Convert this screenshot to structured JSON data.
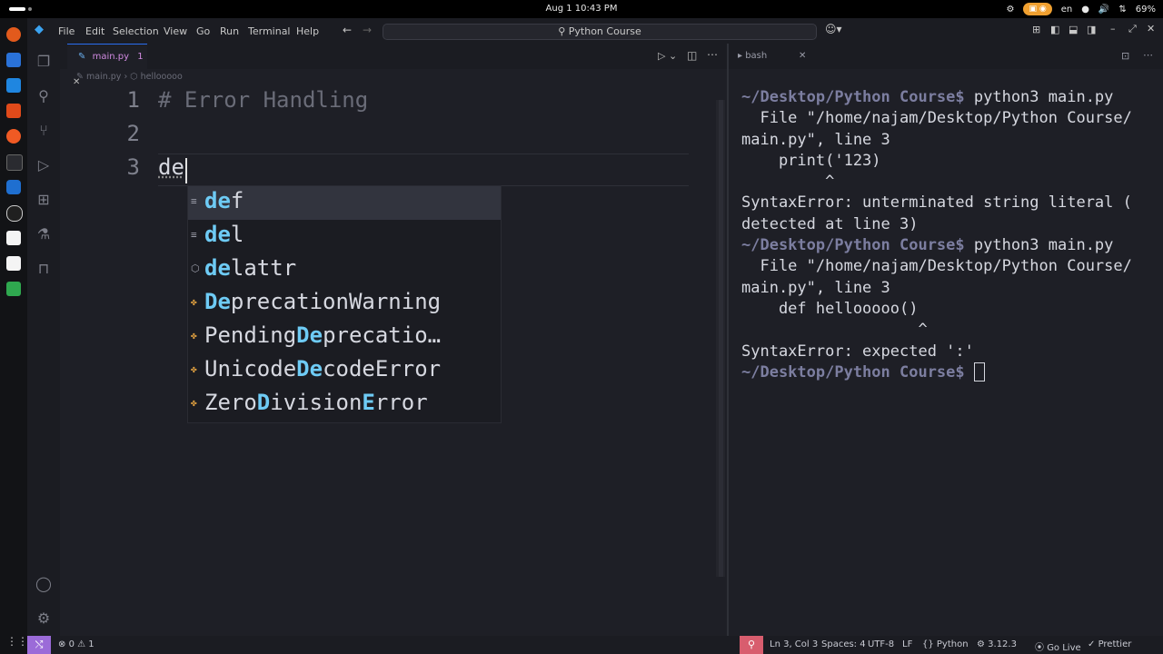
{
  "system": {
    "clock": "Aug 1  10:43 PM",
    "language": "en",
    "battery": "69%"
  },
  "menu": [
    "File",
    "Edit",
    "Selection",
    "View",
    "Go",
    "Run",
    "Terminal",
    "Help"
  ],
  "command_center": "Python Course",
  "editor": {
    "tab_label": "main.py",
    "tab_badge": "1",
    "breadcrumb_file": "main.py",
    "breadcrumb_symbol": "hellooooo",
    "lines": [
      {
        "num": "1",
        "text": "# Error Handling"
      },
      {
        "num": "2",
        "text": ""
      },
      {
        "num": "3",
        "text": "de"
      }
    ],
    "suggestions": [
      {
        "icon": "keyword-icon",
        "match": "de",
        "rest": "f",
        "pre": ""
      },
      {
        "icon": "keyword-icon",
        "match": "de",
        "rest": "l",
        "pre": ""
      },
      {
        "icon": "function-icon",
        "match": "de",
        "rest": "lattr",
        "pre": ""
      },
      {
        "icon": "class-icon",
        "pre": "",
        "match": "De",
        "rest": "precationWarning"
      },
      {
        "icon": "class-icon",
        "pre": "Pending",
        "match": "De",
        "rest": "precatio…"
      },
      {
        "icon": "class-icon",
        "pre": "Unicode",
        "match": "De",
        "rest": "codeError"
      },
      {
        "icon": "class-icon",
        "pre": "Zero",
        "match": "D",
        "rest": "ivision",
        "match2": "E",
        "rest2": "rror"
      }
    ]
  },
  "terminal": {
    "tab_label": "bash",
    "prompt": "~/Desktop/Python Course$",
    "lines": [
      {
        "type": "prompt",
        "cmd": " python3 main.py"
      },
      {
        "type": "out",
        "text": "  File \"/home/najam/Desktop/Python Course/"
      },
      {
        "type": "out",
        "text": "main.py\", line 3"
      },
      {
        "type": "out",
        "text": "    print('123)"
      },
      {
        "type": "out",
        "text": "         ^"
      },
      {
        "type": "out",
        "text": "SyntaxError: unterminated string literal ("
      },
      {
        "type": "out",
        "text": "detected at line 3)"
      },
      {
        "type": "prompt",
        "cmd": " python3 main.py"
      },
      {
        "type": "out",
        "text": "  File \"/home/najam/Desktop/Python Course/"
      },
      {
        "type": "out",
        "text": "main.py\", line 3"
      },
      {
        "type": "out",
        "text": "    def hellooooo()"
      },
      {
        "type": "out",
        "text": "                   ^"
      },
      {
        "type": "out",
        "text": "SyntaxError: expected ':'"
      },
      {
        "type": "prompt",
        "cmd": " "
      }
    ]
  },
  "status": {
    "errors": "0",
    "warnings": "1",
    "position": "Ln 3, Col 3",
    "spaces": "Spaces: 4",
    "encoding": "UTF-8",
    "eol": "LF",
    "language": "Python",
    "version": "3.12.3",
    "golive": "Go Live",
    "prettier": "Prettier"
  }
}
